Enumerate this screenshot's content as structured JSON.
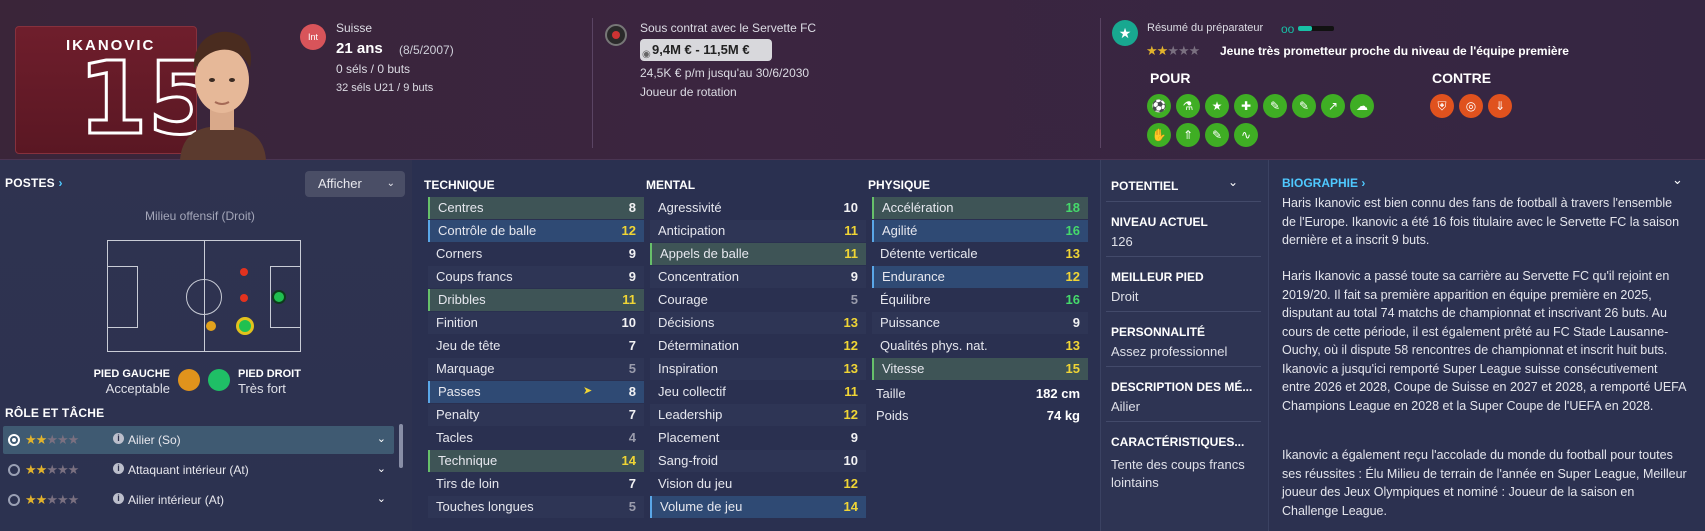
{
  "header": {
    "player_shirt_name": "IKANOVIC",
    "shirt_number": "15",
    "nationality_badge": "Int",
    "nationality": "Suisse",
    "age": "21 ans",
    "birth_date": "(8/5/2007)",
    "caps": "0 séls / 0 buts",
    "u21_caps": "32 séls U21 / 9 buts",
    "contract": "Sous contrat avec le Servette FC",
    "value_range": "9,4M € - 11,5M €",
    "wage": "24,5K € p/m jusqu'au 30/6/2030",
    "squad_status": "Joueur de rotation",
    "coach_summary_label": "Résumé du préparateur",
    "coach_summary_stars": 2,
    "coach_summary_text": "Jeune très prometteur proche du niveau de l'équipe première",
    "pros_label": "POUR",
    "cons_label": "CONTRE",
    "pros_icons": [
      "boot-icon",
      "flask-icon",
      "star-icon",
      "bandage-icon",
      "report-icon",
      "report-icon",
      "trend-up-icon",
      "brain-icon",
      "handshake-icon",
      "arrows-up-icon",
      "report-icon",
      "wave-icon"
    ],
    "cons_icons": [
      "shield-icon",
      "target-icon",
      "arrow-down-icon"
    ]
  },
  "positions": {
    "title": "POSTES",
    "show_button": "Afficher",
    "position_label": "Milieu offensif (Droit)",
    "left_foot_label": "PIED GAUCHE",
    "left_foot_value": "Acceptable",
    "right_foot_label": "PIED DROIT",
    "right_foot_value": "Très fort"
  },
  "roles": {
    "title": "RÔLE ET TÂCHE",
    "items": [
      {
        "label": "Ailier (So)",
        "stars": 2,
        "selected": true
      },
      {
        "label": "Attaquant intérieur (At)",
        "stars": 2,
        "selected": false
      },
      {
        "label": "Ailier intérieur (At)",
        "stars": 2,
        "selected": false
      }
    ]
  },
  "attributes": {
    "technique_title": "TECHNIQUE",
    "mental_title": "MENTAL",
    "physique_title": "PHYSIQUE",
    "technique": [
      {
        "name": "Centres",
        "value": "8",
        "hl": "green",
        "color": "white"
      },
      {
        "name": "Contrôle de balle",
        "value": "12",
        "hl": "blue",
        "color": "yellow"
      },
      {
        "name": "Corners",
        "value": "9",
        "hl": "",
        "color": "white"
      },
      {
        "name": "Coups francs",
        "value": "9",
        "hl": "",
        "color": "white"
      },
      {
        "name": "Dribbles",
        "value": "11",
        "hl": "green",
        "color": "yellow"
      },
      {
        "name": "Finition",
        "value": "10",
        "hl": "",
        "color": "white"
      },
      {
        "name": "Jeu de tête",
        "value": "7",
        "hl": "",
        "color": "white"
      },
      {
        "name": "Marquage",
        "value": "5",
        "hl": "",
        "color": "grey"
      },
      {
        "name": "Passes",
        "value": "8",
        "hl": "blue",
        "color": "white"
      },
      {
        "name": "Penalty",
        "value": "7",
        "hl": "",
        "color": "white"
      },
      {
        "name": "Tacles",
        "value": "4",
        "hl": "",
        "color": "grey"
      },
      {
        "name": "Technique",
        "value": "14",
        "hl": "green",
        "color": "yellow"
      },
      {
        "name": "Tirs de loin",
        "value": "7",
        "hl": "",
        "color": "white"
      },
      {
        "name": "Touches longues",
        "value": "5",
        "hl": "",
        "color": "grey"
      }
    ],
    "mental": [
      {
        "name": "Agressivité",
        "value": "10",
        "hl": "",
        "color": "white"
      },
      {
        "name": "Anticipation",
        "value": "11",
        "hl": "",
        "color": "yellow"
      },
      {
        "name": "Appels de balle",
        "value": "11",
        "hl": "green",
        "color": "yellow"
      },
      {
        "name": "Concentration",
        "value": "9",
        "hl": "",
        "color": "white"
      },
      {
        "name": "Courage",
        "value": "5",
        "hl": "",
        "color": "grey"
      },
      {
        "name": "Décisions",
        "value": "13",
        "hl": "",
        "color": "yellow"
      },
      {
        "name": "Détermination",
        "value": "12",
        "hl": "",
        "color": "yellow"
      },
      {
        "name": "Inspiration",
        "value": "13",
        "hl": "",
        "color": "yellow"
      },
      {
        "name": "Jeu collectif",
        "value": "11",
        "hl": "",
        "color": "yellow"
      },
      {
        "name": "Leadership",
        "value": "12",
        "hl": "",
        "color": "yellow"
      },
      {
        "name": "Placement",
        "value": "9",
        "hl": "",
        "color": "white"
      },
      {
        "name": "Sang-froid",
        "value": "10",
        "hl": "",
        "color": "white"
      },
      {
        "name": "Vision du jeu",
        "value": "12",
        "hl": "",
        "color": "yellow"
      },
      {
        "name": "Volume de jeu",
        "value": "14",
        "hl": "blue",
        "color": "yellow"
      }
    ],
    "physique": [
      {
        "name": "Accélération",
        "value": "18",
        "hl": "green",
        "color": "green"
      },
      {
        "name": "Agilité",
        "value": "16",
        "hl": "blue",
        "color": "green"
      },
      {
        "name": "Détente verticale",
        "value": "13",
        "hl": "",
        "color": "yellow"
      },
      {
        "name": "Endurance",
        "value": "12",
        "hl": "blue",
        "color": "yellow"
      },
      {
        "name": "Équilibre",
        "value": "16",
        "hl": "",
        "color": "green"
      },
      {
        "name": "Puissance",
        "value": "9",
        "hl": "",
        "color": "white"
      },
      {
        "name": "Qualités phys. nat.",
        "value": "13",
        "hl": "",
        "color": "yellow"
      },
      {
        "name": "Vitesse",
        "value": "15",
        "hl": "green",
        "color": "yellow"
      }
    ],
    "height_label": "Taille",
    "height_value": "182 cm",
    "weight_label": "Poids",
    "weight_value": "74 kg"
  },
  "info": {
    "potential_label": "POTENTIEL",
    "current_level_label": "NIVEAU ACTUEL",
    "current_level_value": "126",
    "best_foot_label": "MEILLEUR PIED",
    "best_foot_value": "Droit",
    "personality_label": "PERSONNALITÉ",
    "personality_value": "Assez professionnel",
    "description_label": "DESCRIPTION DES MÉ...",
    "description_value": "Ailier",
    "traits_label": "CARACTÉRISTIQUES...",
    "traits_value_1": "Tente des coups francs",
    "traits_value_2": "lointains"
  },
  "bio": {
    "title": "BIOGRAPHIE",
    "p1": "Haris Ikanovic est bien connu des fans de football à travers l'ensemble de l'Europe. Ikanovic a été 16 fois titulaire avec le Servette FC la saison dernière et a inscrit 9 buts.",
    "p2": "Haris Ikanovic a passé toute sa carrière au Servette FC qu'il rejoint en 2019/20. Il fait sa première apparition en équipe première en 2025, disputant au total 74 matchs de championnat et inscrivant 26 buts. Au cours de cette période, il est également prêté au FC Stade Lausanne-Ouchy, où il dispute 58 rencontres de championnat et inscrit huit buts. Ikanovic a jusqu'ici remporté Super League suisse consécutivement entre 2026 et 2028, Coupe de Suisse en 2027 et 2028, a remporté UEFA Champions League en 2028 et la Super Coupe de l'UEFA en 2028.",
    "p3": "Ikanovic a également reçu l'accolade du monde du football pour toutes ses réussites : Élu Milieu de terrain de l'année en Super League, Meilleur joueur des Jeux Olympiques et nominé : Joueur de la saison en Challenge League."
  },
  "colors": {
    "accent": "#4fc9ff",
    "pro_green": "#3fae24",
    "con_orange": "#e0521e",
    "star_gold": "#e2b32c"
  }
}
